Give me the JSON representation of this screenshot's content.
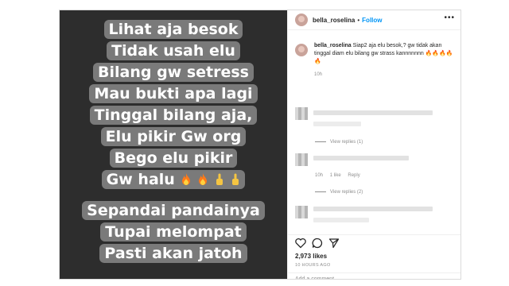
{
  "post": {
    "story_lines": [
      "Lihat aja besok",
      "Tidak usah elu",
      "Bilang gw setress",
      "Mau bukti apa lagi",
      "Tinggal bilang aja,",
      "Elu pikir Gw org",
      "Bego elu pikir",
      "Gw halu"
    ],
    "story_lines_2": [
      "Sepandai pandainya",
      "Tupai melompat",
      "Pasti akan jatoh"
    ],
    "emojis": [
      "fire-emoji",
      "fire-emoji",
      "pointing-up-emoji",
      "pointing-up-emoji"
    ]
  },
  "header": {
    "username": "bella_roselina",
    "separator": "•",
    "follow_label": "Follow",
    "more_label": "•••"
  },
  "caption": {
    "username": "bella_roselina",
    "text": "Siap2 aja elu besok,? gw tidak akan tinggal diam elu bilang gw strass kannnnnnn 🔥🔥🔥🔥🔥",
    "time": "10h"
  },
  "comments": {
    "view_replies_1": "View replies (1)",
    "c2_time": "10h",
    "c2_likes": "1 like",
    "c2_reply": "Reply",
    "view_replies_2": "View replies (2)"
  },
  "footer": {
    "likes": "2,973 likes",
    "posted": "10 HOURS AGO",
    "add_comment": "Add a comment..."
  },
  "colors": {
    "accent": "#0095f6",
    "media_bg": "#2d2d2d",
    "story_box": "#7a7a7a"
  }
}
